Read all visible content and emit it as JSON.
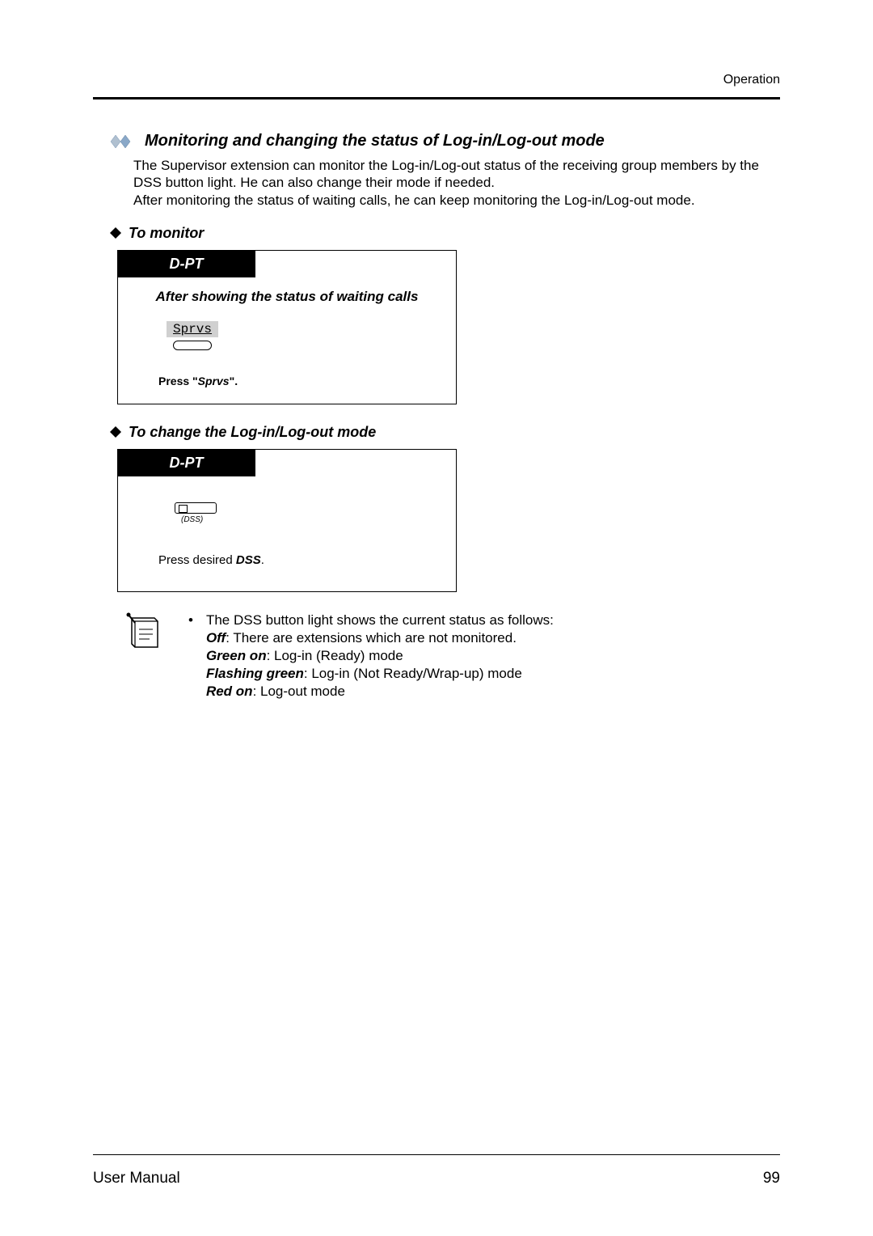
{
  "header": {
    "label": "Operation"
  },
  "section": {
    "title": "Monitoring and changing the status of Log-in/Log-out mode",
    "intro": "The Supervisor extension can monitor the Log-in/Log-out status of the receiving group members by the DSS button light. He can also change their mode if needed.\nAfter monitoring the status of waiting calls, he can keep monitoring the Log-in/Log-out mode."
  },
  "monitor": {
    "heading": "To monitor",
    "panel_label": "D-PT",
    "caption": "After showing the status of waiting calls",
    "button_label": "Sprvs",
    "press_prefix": "Press \"",
    "press_italic": "Sprvs",
    "press_suffix": "\"."
  },
  "change": {
    "heading": "To change the Log-in/Log-out mode",
    "panel_label": "D-PT",
    "dss_caption": "(DSS)",
    "press_text_pre": "Press desired ",
    "press_text_bold": "DSS",
    "press_text_post": "."
  },
  "note": {
    "line1": "The DSS button light shows the current status as follows:",
    "off_label": "Off",
    "off_text": ": There are extensions which are not monitored.",
    "green_label": "Green on",
    "green_text": ": Log-in (Ready) mode",
    "flash_label": "Flashing green",
    "flash_text": ": Log-in (Not Ready/Wrap-up) mode",
    "red_label": "Red on",
    "red_text": ": Log-out mode"
  },
  "footer": {
    "left": "User Manual",
    "right": "99"
  }
}
